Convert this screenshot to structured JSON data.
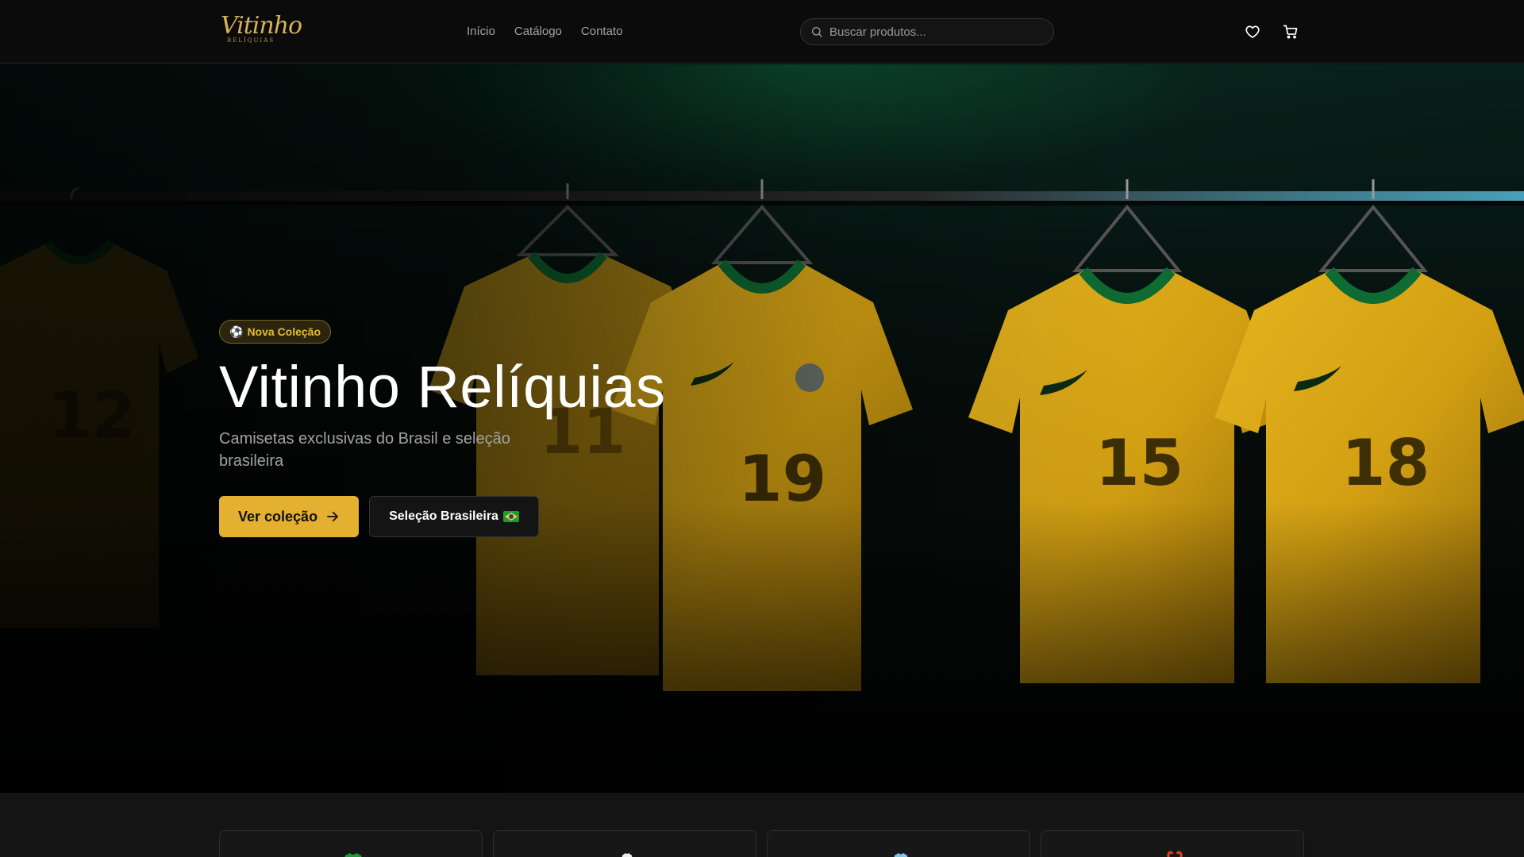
{
  "header": {
    "logo": {
      "main": "Vitinho",
      "sub": "RELÍQUIAS"
    },
    "nav": [
      "Início",
      "Catálogo",
      "Contato"
    ],
    "search": {
      "placeholder": "Buscar produtos...",
      "icon": "search-icon"
    },
    "icons": [
      "heart-icon",
      "cart-icon"
    ]
  },
  "hero": {
    "badge": "Nova Coleção",
    "badge_icon": "soccer-ball-icon",
    "title": "Vitinho Relíquias",
    "subtitle": "Camisetas exclusivas do Brasil e seleção brasileira",
    "primary_button": "Ver coleção",
    "secondary_button": "Seleção Brasileira",
    "jersey_numbers": [
      "12",
      "11",
      "19",
      "15",
      "18"
    ]
  },
  "categories": {
    "cards": [
      {
        "icon": "green-shirt-icon"
      },
      {
        "icon": "white-shirt-icon"
      },
      {
        "icon": "blue-shirt-icon"
      },
      {
        "icon": "red-shirt-icon"
      }
    ]
  },
  "colors": {
    "accent": "#e3b02f",
    "background": "#0a0a0a",
    "jersey_yellow": "#d9a81a",
    "jersey_green": "#0e6b32"
  }
}
